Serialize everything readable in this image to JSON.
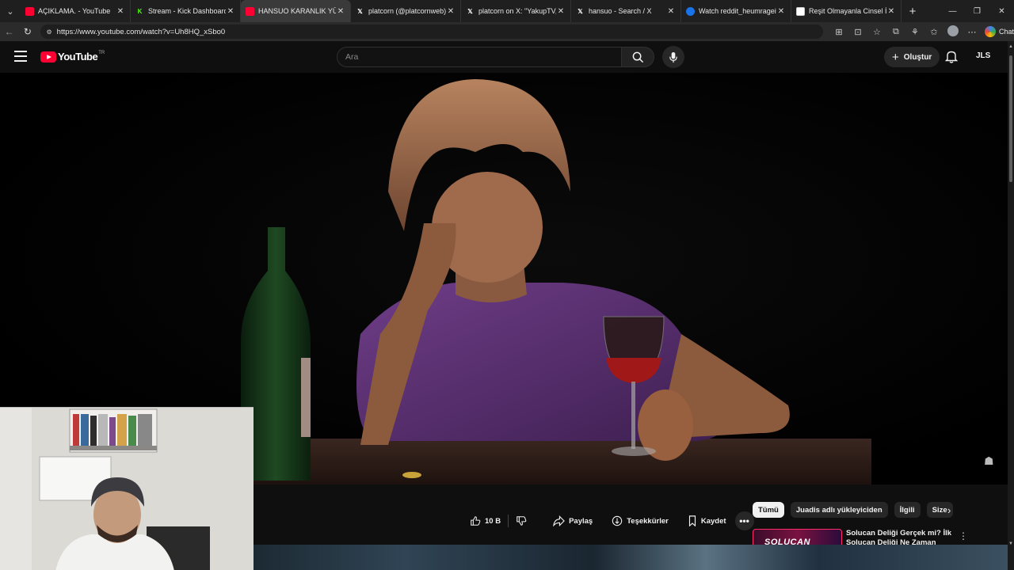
{
  "browser": {
    "tabs": [
      {
        "title": "AÇIKLAMA. - YouTube",
        "icon": "youtube-icon",
        "color": "#ff0033",
        "active": false
      },
      {
        "title": "Stream - Kick Dashboard",
        "icon": "kick-icon",
        "color": "#53fc18",
        "active": false
      },
      {
        "title": "HANSUO KARANLIK YÜZÜ",
        "icon": "youtube-icon",
        "color": "#ff0033",
        "active": true
      },
      {
        "title": "platcorn (@platcornweb) / X",
        "icon": "x-icon",
        "color": "#000000",
        "active": false
      },
      {
        "title": "platcorn on X: \"YakupTV, Gr",
        "icon": "x-icon",
        "color": "#000000",
        "active": false
      },
      {
        "title": "hansuo - Search / X",
        "icon": "x-icon",
        "color": "#000000",
        "active": false
      },
      {
        "title": "Watch reddit_heumrageifsar",
        "icon": "reddit-icon",
        "color": "#1a73e8",
        "active": false
      },
      {
        "title": "Reşit Olmayanla Cinsel İlişk",
        "icon": "document-icon",
        "color": "#ffffff",
        "active": false
      }
    ],
    "url": "https://www.youtube.com/watch?v=Uh8HQ_xSbo0",
    "chat_label": "Chat"
  },
  "youtube": {
    "logo_text": "YouTube",
    "region_code": "TR",
    "search_placeholder": "Ara",
    "create_label": "Oluştur",
    "account_initials": "JLS"
  },
  "actions": {
    "like_count": "10 B",
    "share_label": "Paylaş",
    "thanks_label": "Teşekkürler",
    "save_label": "Kaydet"
  },
  "chips": [
    "Tümü",
    "Juadis adlı yükleyiciden",
    "İlgili",
    "Size"
  ],
  "recommendation": {
    "thumb_text": "SOLUCAN",
    "title": "Solucan Deliği Gerçek mi? İlk Solucan Deliği Ne Zaman"
  }
}
